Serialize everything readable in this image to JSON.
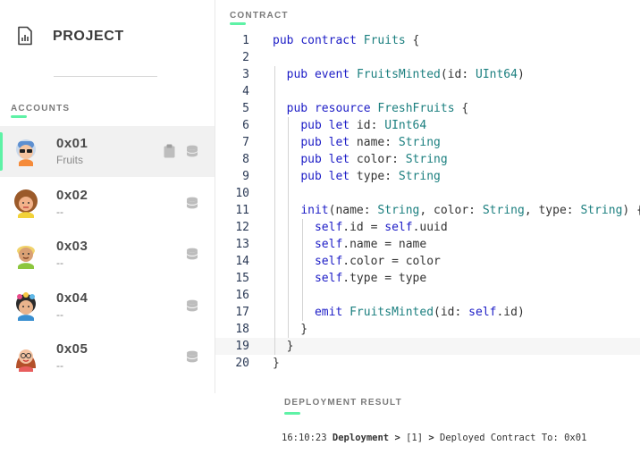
{
  "project": {
    "title": "PROJECT",
    "icon": "document-chart-icon"
  },
  "accounts": {
    "label": "ACCOUNTS",
    "items": [
      {
        "address": "0x01",
        "subtitle": "Fruits",
        "avatar": "avatar-sunglasses-icon",
        "active": true
      },
      {
        "address": "0x02",
        "subtitle": "--",
        "avatar": "avatar-curly-hair-icon",
        "active": false
      },
      {
        "address": "0x03",
        "subtitle": "--",
        "avatar": "avatar-blonde-icon",
        "active": false
      },
      {
        "address": "0x04",
        "subtitle": "--",
        "avatar": "avatar-flower-hair-icon",
        "active": false
      },
      {
        "address": "0x05",
        "subtitle": "--",
        "avatar": "avatar-glasses-red-hair-icon",
        "active": false
      }
    ]
  },
  "editor": {
    "label": "CONTRACT",
    "lines": [
      {
        "n": "1",
        "html": "<span class=\"kw\">pub</span> <span class=\"kw\">contract</span> <span class=\"ty\">Fruits</span> {"
      },
      {
        "n": "2",
        "html": ""
      },
      {
        "n": "3",
        "html": "  <span class=\"kw\">pub</span> <span class=\"kw\">event</span> <span class=\"ty\">FruitsMinted</span>(id: <span class=\"ty\">UInt64</span>)"
      },
      {
        "n": "4",
        "html": ""
      },
      {
        "n": "5",
        "html": "  <span class=\"kw\">pub</span> <span class=\"kw\">resource</span> <span class=\"ty\">FreshFruits</span> {"
      },
      {
        "n": "6",
        "html": "    <span class=\"kw\">pub</span> <span class=\"kw\">let</span> id: <span class=\"ty\">UInt64</span>"
      },
      {
        "n": "7",
        "html": "    <span class=\"kw\">pub</span> <span class=\"kw\">let</span> name: <span class=\"ty\">String</span>"
      },
      {
        "n": "8",
        "html": "    <span class=\"kw\">pub</span> <span class=\"kw\">let</span> color: <span class=\"ty\">String</span>"
      },
      {
        "n": "9",
        "html": "    <span class=\"kw\">pub</span> <span class=\"kw\">let</span> type: <span class=\"ty\">String</span>"
      },
      {
        "n": "10",
        "html": ""
      },
      {
        "n": "11",
        "html": "    <span class=\"kw\">init</span>(name: <span class=\"ty\">String</span>, color: <span class=\"ty\">String</span>, type: <span class=\"ty\">String</span>) {"
      },
      {
        "n": "12",
        "html": "      <span class=\"kw\">self</span>.id = <span class=\"kw\">self</span>.uuid"
      },
      {
        "n": "13",
        "html": "      <span class=\"kw\">self</span>.name = name"
      },
      {
        "n": "14",
        "html": "      <span class=\"kw\">self</span>.color = color"
      },
      {
        "n": "15",
        "html": "      <span class=\"kw\">self</span>.type = type"
      },
      {
        "n": "16",
        "html": ""
      },
      {
        "n": "17",
        "html": "      <span class=\"kw\">emit</span> <span class=\"ty\">FruitsMinted</span>(id: <span class=\"kw\">self</span>.id)"
      },
      {
        "n": "18",
        "html": "    }"
      },
      {
        "n": "19",
        "html": "  }"
      },
      {
        "n": "20",
        "html": "}"
      }
    ]
  },
  "result": {
    "label": "DEPLOYMENT RESULT",
    "time": "16:10:23",
    "source": "Deployment",
    "sep1": " > ",
    "index": "[1]",
    "sep2": " > ",
    "message": "Deployed Contract To: 0x01"
  },
  "colors": {
    "accent": "#5ef2a6",
    "keyword": "#1c1cc6",
    "type": "#1b7f7f"
  }
}
